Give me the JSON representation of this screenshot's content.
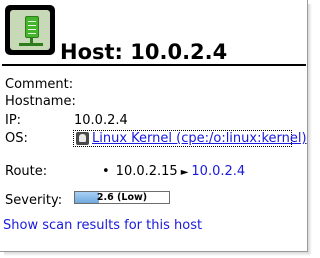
{
  "header": {
    "icon": "host-server-icon",
    "title": "Host: 10.0.2.4"
  },
  "details": {
    "comment_label": "Comment:",
    "comment_value": "",
    "hostname_label": "Hostname:",
    "hostname_value": "",
    "ip_label": "IP:",
    "ip_value": "10.0.2.4",
    "os_label": "OS:",
    "os_icon": "linux-os-icon",
    "os_value": "Linux Kernel (cpe:/o:linux:kernel)",
    "route_label": "Route:",
    "route_hops": [
      "10.0.2.15",
      "10.0.2.4"
    ],
    "route_separator": "►",
    "severity_label": "Severity:",
    "severity_text": "2.6 (Low)",
    "severity_score": 2.6,
    "severity_max": 10,
    "severity_color": "#6fa8dc"
  },
  "actions": {
    "scan_results_link": "Show scan results for this host"
  },
  "colors": {
    "link": "#1a1adc",
    "icon_green": "#45b52e"
  }
}
